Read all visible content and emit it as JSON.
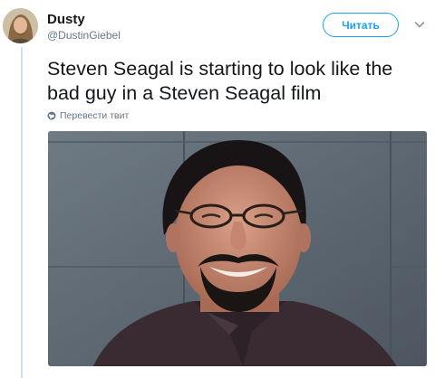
{
  "tweet": {
    "author_name": "Dusty",
    "author_handle": "@DustinGiebel",
    "follow_label": "Читать",
    "text": "Steven Seagal is starting to look like the bad guy in a Steven Seagal film",
    "translate_label": "Перевести твит"
  },
  "icons": {
    "avatar": "avatar",
    "caret": "chevron-down-icon",
    "globe": "globe-icon"
  },
  "colors": {
    "accent": "#1da1f2",
    "secondary_text": "#657786",
    "primary_text": "#14171a",
    "thread_line": "#c4e3f3"
  }
}
